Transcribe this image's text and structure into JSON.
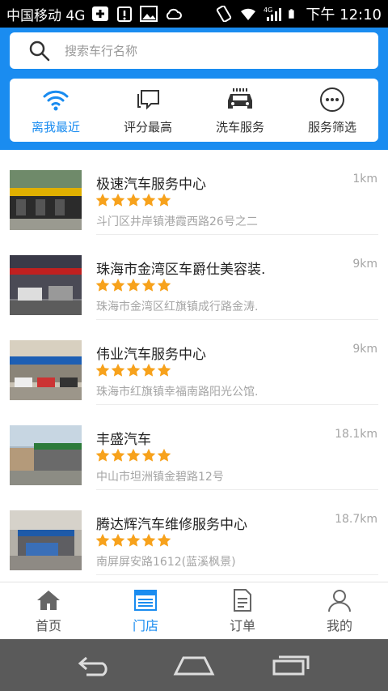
{
  "status_bar": {
    "carrier": "中国移动 4G",
    "network": "4G",
    "time": "下午 12:10"
  },
  "search": {
    "placeholder": "搜索车行名称",
    "value": ""
  },
  "filters": [
    {
      "label": "离我最近",
      "icon": "wifi-signal-icon",
      "active": true
    },
    {
      "label": "评分最高",
      "icon": "chat-bubble-icon",
      "active": false
    },
    {
      "label": "洗车服务",
      "icon": "car-wash-icon",
      "active": false
    },
    {
      "label": "服务筛选",
      "icon": "more-dots-icon",
      "active": false
    }
  ],
  "shops": [
    {
      "name": "极速汽车服务中心",
      "distance": "1km",
      "rating": 5,
      "address": "斗门区井岸镇港霞西路26号之二"
    },
    {
      "name": "珠海市金湾区车爵仕美容装.",
      "distance": "9km",
      "rating": 5,
      "address": "珠海市金湾区红旗镇成行路金涛."
    },
    {
      "name": "伟业汽车服务中心",
      "distance": "9km",
      "rating": 5,
      "address": "珠海市红旗镇幸福南路阳光公馆."
    },
    {
      "name": "丰盛汽车",
      "distance": "18.1km",
      "rating": 5,
      "address": "中山市坦洲镇金碧路12号"
    },
    {
      "name": "腾达辉汽车维修服务中心",
      "distance": "18.7km",
      "rating": 5,
      "address": "南屏屏安路1612(蓝溪枫景)"
    }
  ],
  "bottom_nav": [
    {
      "label": "首页",
      "icon": "home-icon",
      "active": false
    },
    {
      "label": "门店",
      "icon": "store-icon",
      "active": true
    },
    {
      "label": "订单",
      "icon": "order-document-icon",
      "active": false
    },
    {
      "label": "我的",
      "icon": "profile-icon",
      "active": false
    }
  ],
  "colors": {
    "accent": "#1a8cf0",
    "star": "#f7a21c",
    "header_bg": "#1a8cf0",
    "system_nav_bg": "#5a5a5a"
  }
}
